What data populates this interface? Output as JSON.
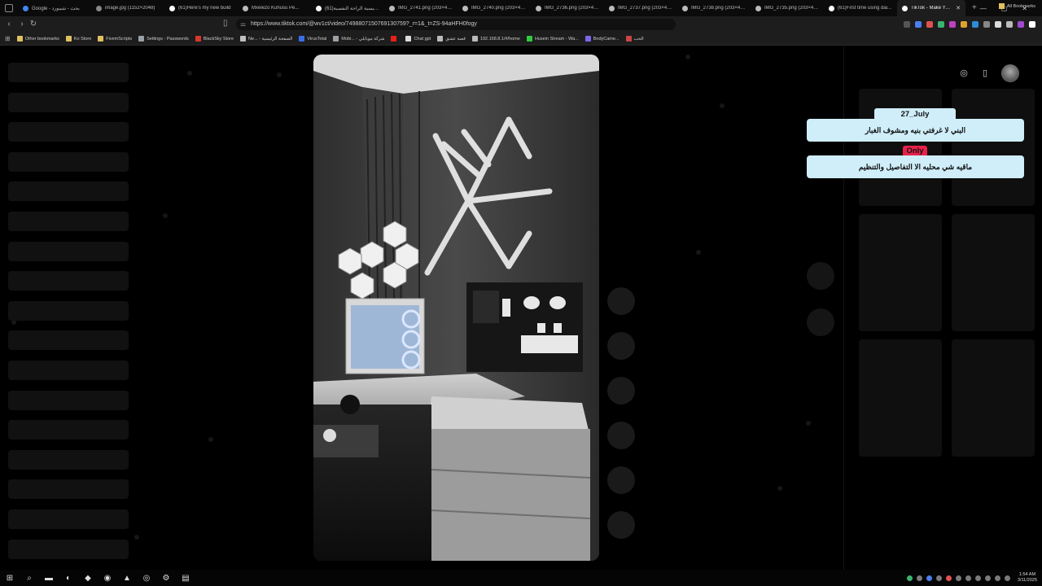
{
  "browser": {
    "tabs": [
      {
        "title": "Google - بحث - شيبورد",
        "color": "#4285f4",
        "active": false
      },
      {
        "title": "image.jpg (1152×2048)",
        "color": "#888888",
        "active": false
      },
      {
        "title": "(61)Here's my new build",
        "color": "#ffffff",
        "active": false
      },
      {
        "title": "Mxelezo Kuhusu Pe...",
        "color": "#bbbbbb",
        "active": false
      },
      {
        "title": "(61)الرئيسية الراحة النفسية",
        "color": "#ffffff",
        "active": false
      },
      {
        "title": "IMG_2741.png (203×44...",
        "color": "#bbbbbb",
        "active": false
      },
      {
        "title": "IMG_2740.png (203×44...",
        "color": "#bbbbbb",
        "active": false
      },
      {
        "title": "IMG_2736.png (203×44...",
        "color": "#bbbbbb",
        "active": false
      },
      {
        "title": "IMG_2737.png (203×44...",
        "color": "#bbbbbb",
        "active": false
      },
      {
        "title": "IMG_2738.png (203×44...",
        "color": "#bbbbbb",
        "active": false
      },
      {
        "title": "IMG_2735.png (203×44...",
        "color": "#bbbbbb",
        "active": false
      },
      {
        "title": "(61)First time using dai...",
        "color": "#ffffff",
        "active": false
      },
      {
        "title": "TikTok - Make Your...",
        "color": "#ffffff",
        "active": true
      }
    ],
    "new_tab": "+",
    "window_controls": [
      "—",
      "▢",
      "✕"
    ],
    "url": "https://www.tiktok.com/@wv1ct/video/7498807150769130759?_r=1&_t=ZS-94aHFH0fogy",
    "bookmarks": [
      {
        "label": "Other bookmarks",
        "color": "#e0c060"
      },
      {
        "label": "Ko Store",
        "color": "#e0c060"
      },
      {
        "label": "FivemScripts",
        "color": "#e0c060"
      },
      {
        "label": "Settings - Passwords",
        "color": "#9aa0a6"
      },
      {
        "label": "BlackSky Store",
        "color": "#d9362d"
      },
      {
        "label": "Ne... - الصفحة الرئيسية",
        "color": "#c0c0c0"
      },
      {
        "label": "VirusTotal",
        "color": "#3a6ee8"
      },
      {
        "label": "Mobi... - شركة موبايلي",
        "color": "#9aa0a6"
      },
      {
        "label": "",
        "color": "#e62117"
      },
      {
        "label": "Chat gpt",
        "color": "#dddddd"
      },
      {
        "label": "قصة عشق",
        "color": "#bbbbbb"
      },
      {
        "label": "192.168.8.1/#/home",
        "color": "#bbbbbb"
      },
      {
        "label": "Husein Stream - Wa...",
        "color": "#2ecc40"
      },
      {
        "label": "BodyCame...",
        "color": "#7b68ee"
      },
      {
        "label": "الحب",
        "color": "#cc4444"
      }
    ],
    "all_bookmarks": "All Bookmarks"
  },
  "right_panel": {
    "tag_top": "27_July",
    "comment_1": "البني لا غرفتي بنيه ومشوف الغبار",
    "tag_mid": "Only",
    "comment_2": "ماقيه شي محليه الا التفاصيل والتنظيم"
  },
  "taskbar": {
    "time": "1:54 AM",
    "date": "3/11/2025",
    "apps": [
      {
        "name": "windows-start",
        "glyph": "⊞"
      },
      {
        "name": "search",
        "glyph": "⌕"
      },
      {
        "name": "file-explorer",
        "glyph": "▬"
      },
      {
        "name": "steam",
        "glyph": "◐"
      },
      {
        "name": "brave",
        "glyph": "◆"
      },
      {
        "name": "discord",
        "glyph": "◉"
      },
      {
        "name": "adobe",
        "glyph": "▲"
      },
      {
        "name": "media",
        "glyph": "◎"
      },
      {
        "name": "settings",
        "glyph": "⚙"
      },
      {
        "name": "notes",
        "glyph": "▤"
      }
    ]
  }
}
